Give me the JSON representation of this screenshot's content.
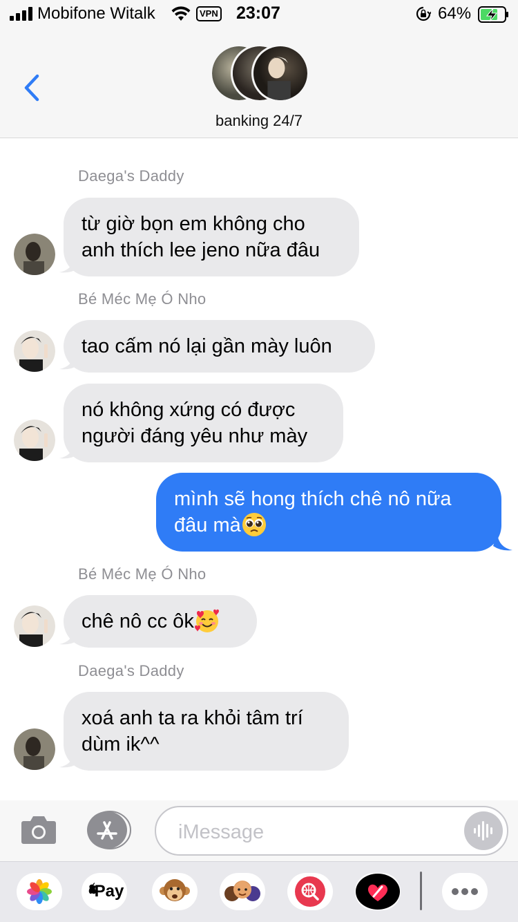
{
  "status_bar": {
    "carrier": "Mobifone Witalk",
    "vpn": "VPN",
    "time": "23:07",
    "battery": "64%"
  },
  "header": {
    "group_name": "banking 24/7",
    "icons": [
      "back-chevron-icon"
    ]
  },
  "messages": [
    {
      "sender": "Daega's Daddy",
      "lines": [
        "từ giờ bọn em không cho",
        "anh thích lee jeno nữa đâu"
      ]
    },
    {
      "sender": "Bé Méc Mẹ Ó Nho",
      "lines": [
        "tao cấm nó lại gần mày luôn"
      ]
    },
    {
      "sender": "",
      "lines": [
        "nó không xứng có được",
        "người đáng yêu như mày"
      ]
    },
    {
      "sender": "me",
      "lines": [
        "mình sẽ hong thích chê nô nữa",
        "đâu mà"
      ],
      "emoji": "pleading-face-emoji"
    },
    {
      "sender": "Bé Méc Mẹ Ó Nho",
      "lines": [
        "chê nô cc ôk"
      ],
      "emoji": "smiling-face-with-hearts-emoji"
    },
    {
      "sender": "Daega's Daddy",
      "lines": [
        "xoá anh ta ra khỏi tâm trí",
        "dùm ik^^"
      ]
    }
  ],
  "compose": {
    "placeholder": "iMessage",
    "icons": [
      "camera-icon",
      "app-store-icon",
      "audio-waveform-icon"
    ]
  },
  "app_drawer": {
    "pay_label": "Pay",
    "apps": [
      "photos-icon",
      "apple-pay-icon",
      "animoji-monkey-icon",
      "memoji-icon",
      "web-search-icon",
      "digital-touch-icon",
      "more-icon"
    ]
  },
  "colors": {
    "outgoing_bubble": "#2f7cf6",
    "incoming_bubble": "#e9e9eb",
    "accent": "#2f7cf6"
  }
}
